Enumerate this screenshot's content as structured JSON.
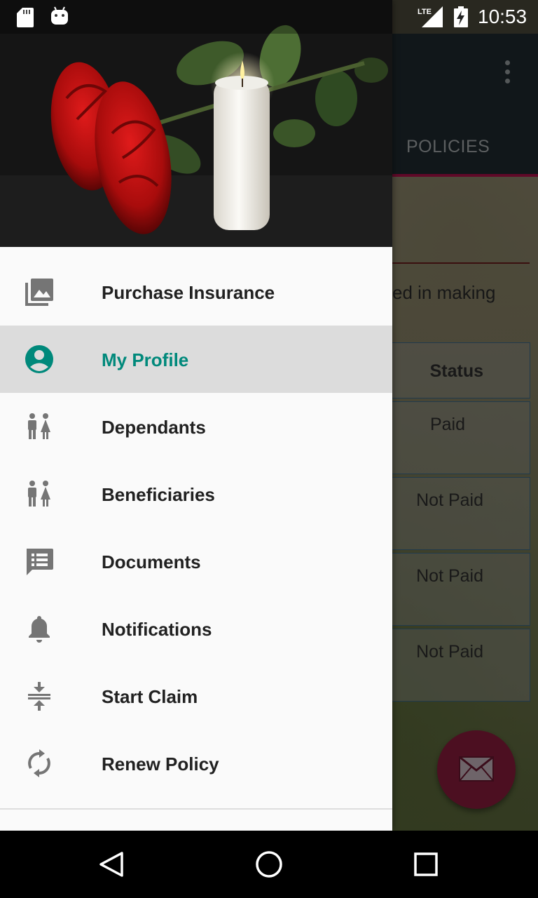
{
  "status_bar": {
    "time": "10:53",
    "network": "LTE",
    "icons": [
      "sd-card-icon",
      "android-icon",
      "lte-signal-icon",
      "battery-charging-icon"
    ]
  },
  "background_app": {
    "tab_label": "POLICIES",
    "intro_text_fragment": "ed in making",
    "status_header": "Status",
    "status_values": [
      "Paid",
      "Not Paid",
      "Not Paid",
      "Not Paid"
    ],
    "fab_icon": "mail-icon"
  },
  "drawer": {
    "header_image": "roses-and-candle-image",
    "items": [
      {
        "label": "Purchase Insurance",
        "icon": "photo-library-icon",
        "selected": false
      },
      {
        "label": "My Profile",
        "icon": "account-circle-icon",
        "selected": true
      },
      {
        "label": "Dependants",
        "icon": "people-icon",
        "selected": false
      },
      {
        "label": "Beneficiaries",
        "icon": "people-icon",
        "selected": false
      },
      {
        "label": "Documents",
        "icon": "message-list-icon",
        "selected": false
      },
      {
        "label": "Notifications",
        "icon": "bell-icon",
        "selected": false
      },
      {
        "label": "Start Claim",
        "icon": "compress-icon",
        "selected": false
      },
      {
        "label": "Renew Policy",
        "icon": "refresh-icon",
        "selected": false
      }
    ]
  },
  "nav_bar": {
    "icons": [
      "back-icon",
      "home-icon",
      "recents-icon"
    ]
  },
  "colors": {
    "accent": "#00897b",
    "selected_background": "#dcdcdc",
    "toolbar": "#1f2a31",
    "tab_indicator": "#b0124a",
    "fab": "#8a1d3d"
  }
}
